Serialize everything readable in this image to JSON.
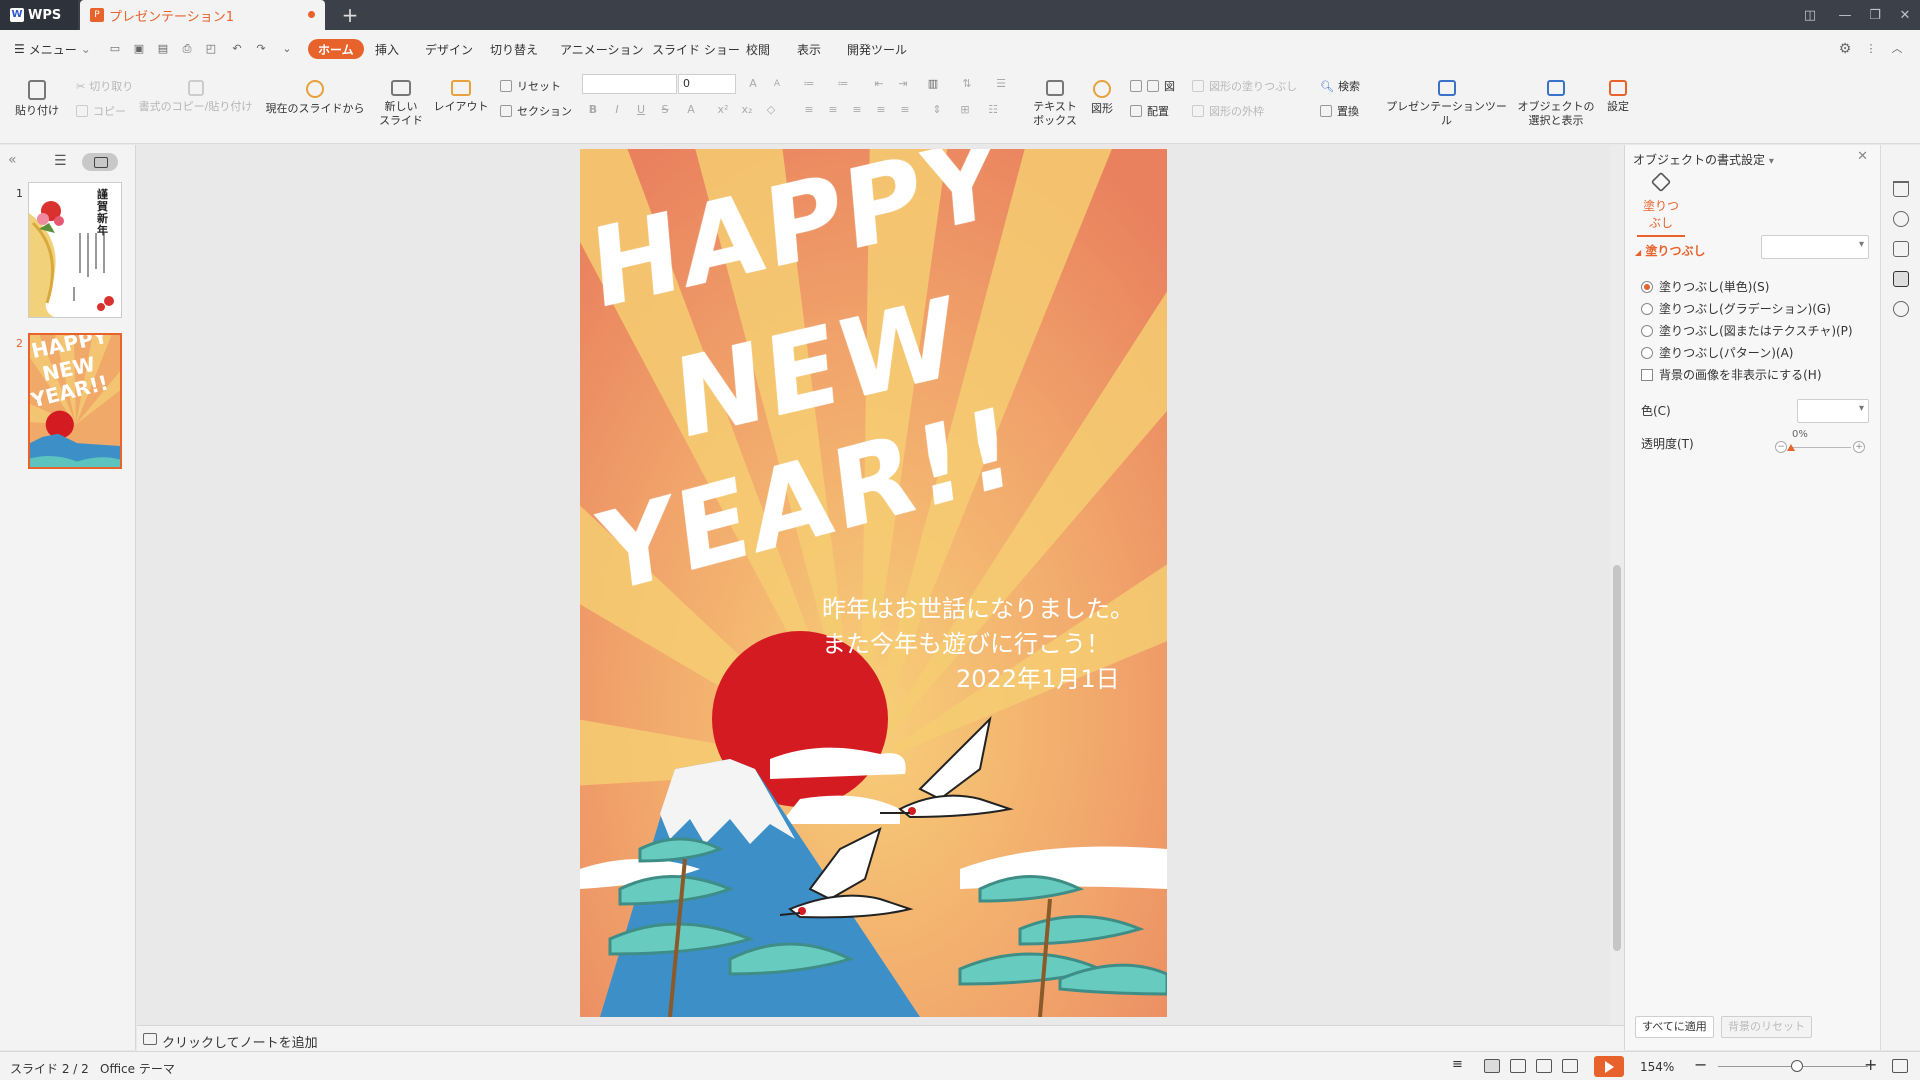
{
  "titlebar": {
    "app_name": "WPS",
    "doc_tab": "プレゼンテーション1",
    "new_tab": "+"
  },
  "menu": {
    "menu_label": "メニュー",
    "tabs": [
      "ホーム",
      "挿入",
      "デザイン",
      "切り替え",
      "アニメーション",
      "スライド ショー",
      "校閲",
      "表示",
      "開発ツール"
    ],
    "active_tab": "ホーム"
  },
  "ribbon": {
    "paste": "貼り付け",
    "cut": "切り取り",
    "copy": "コピー",
    "format_painter": "書式のコピー/貼り付け",
    "from_current": "現在のスライドから",
    "new_slide_1": "新しい",
    "new_slide_2": "スライド",
    "layout": "レイアウト",
    "reset": "リセット",
    "section": "セクション",
    "font_size": "0",
    "textbox_1": "テキスト",
    "textbox_2": "ボックス",
    "shapes": "図形",
    "picture": "図",
    "arrange": "配置",
    "shape_fill": "図形の塗りつぶし",
    "shape_outline": "図形の外枠",
    "find": "検索",
    "replace": "置換",
    "pres_tools": "プレゼンテーションツール",
    "select_show_1": "オブジェクトの",
    "select_show_2": "選択と表示",
    "settings": "設定"
  },
  "slides_pane": {
    "numbers": [
      "1",
      "2"
    ]
  },
  "slide": {
    "headline": [
      "HAPPY",
      "NEW",
      "YEAR!!"
    ],
    "greeting": [
      "昨年はお世話になりました。",
      "また今年も遊びに行こう！",
      "2022年1月1日"
    ]
  },
  "thumb1": {
    "title": "謹賀新年"
  },
  "notes": {
    "placeholder": "クリックしてノートを追加"
  },
  "taskpane": {
    "title": "オブジェクトの書式設定",
    "fill_tab": "塗りつぶし",
    "section": "塗りつぶし",
    "options": [
      "塗りつぶし(単色)(S)",
      "塗りつぶし(グラデーション)(G)",
      "塗りつぶし(図またはテクスチャ)(P)",
      "塗りつぶし(パターン)(A)"
    ],
    "hide_bg": "背景の画像を非表示にする(H)",
    "color_label": "色(C)",
    "transparency_label": "透明度(T)",
    "transparency_value": "0%",
    "apply_all": "すべてに適用",
    "reset_bg": "背景のリセット"
  },
  "statusbar": {
    "slide_info": "スライド 2 / 2",
    "theme": "Office テーマ",
    "zoom": "154%"
  },
  "colors": {
    "accent": "#e8622c",
    "titlebar": "#3b4049",
    "sun_red": "#d51b22",
    "sky_orange": "#f0a968"
  }
}
